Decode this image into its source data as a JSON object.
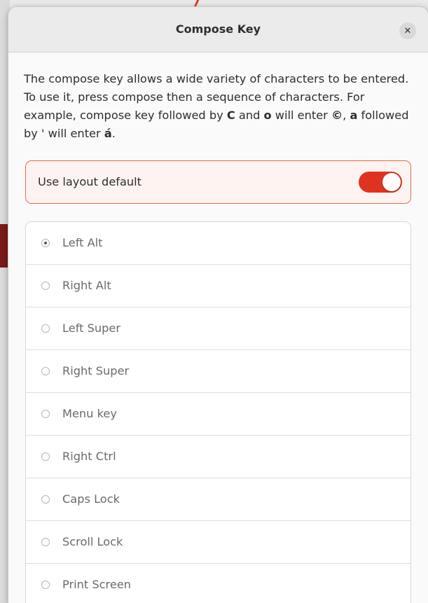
{
  "dialog": {
    "title": "Compose Key",
    "close_icon": "close-icon",
    "description_parts": {
      "p1": "The compose key allows a wide variety of characters to be entered. To use it, press compose then a sequence of characters.  For example, compose key followed by ",
      "b1": "C",
      "p2": " and ",
      "b2": "o",
      "p3": " will enter ",
      "b3": "©",
      "p4": ", ",
      "b4": "a",
      "p5": " followed by ' will enter ",
      "b5": "á",
      "p6": "."
    },
    "use_layout_default": {
      "label": "Use layout default",
      "enabled": true
    },
    "options": [
      {
        "label": "Left Alt",
        "selected": true
      },
      {
        "label": "Right Alt",
        "selected": false
      },
      {
        "label": "Left Super",
        "selected": false
      },
      {
        "label": "Right Super",
        "selected": false
      },
      {
        "label": "Menu key",
        "selected": false
      },
      {
        "label": "Right Ctrl",
        "selected": false
      },
      {
        "label": "Caps Lock",
        "selected": false
      },
      {
        "label": "Scroll Lock",
        "selected": false
      },
      {
        "label": "Print Screen",
        "selected": false
      }
    ]
  },
  "colors": {
    "accent": "#e0331f",
    "switch_border": "#e8694a"
  }
}
